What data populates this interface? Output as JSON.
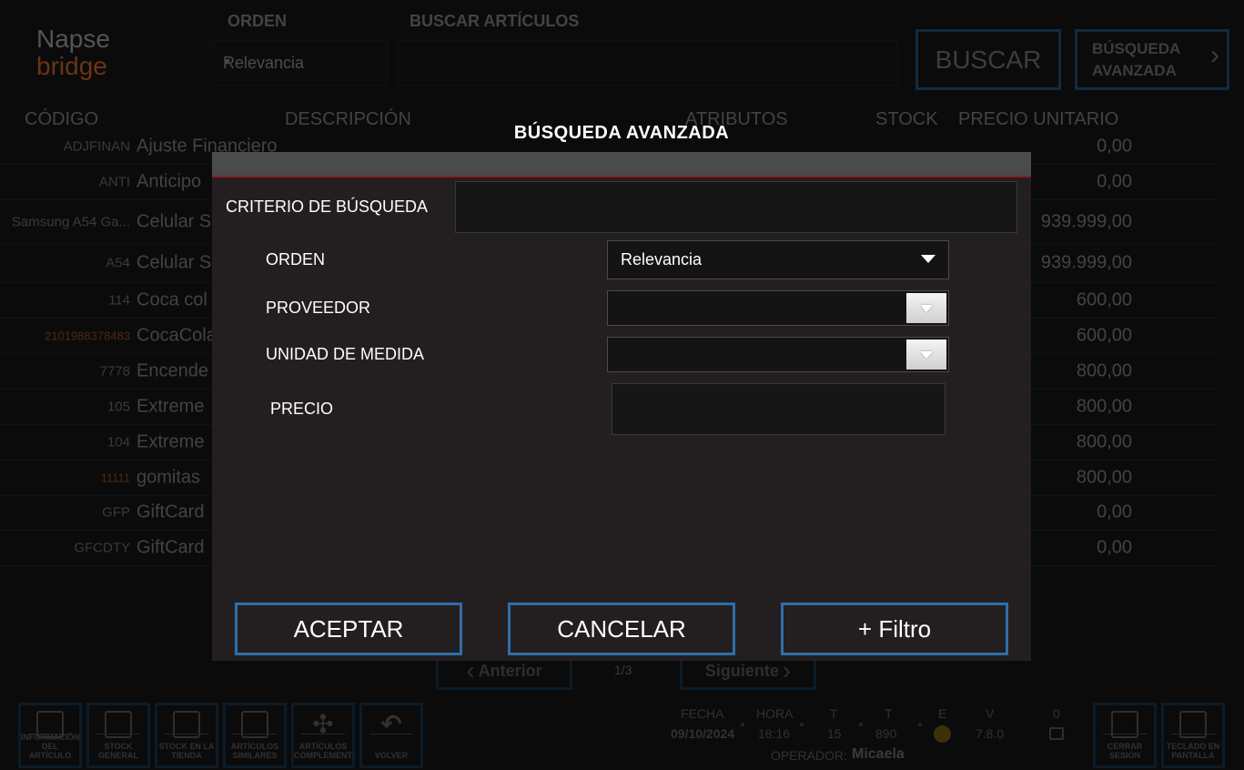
{
  "logo": {
    "line1": "Napse",
    "line2": "bridge"
  },
  "header": {
    "orden_label": "ORDEN",
    "orden_value": "Relevancia",
    "search_label": "BUSCAR ARTÍCULOS",
    "search_value": "",
    "buscar_button": "BUSCAR",
    "advanced_button_line1": "BÚSQUEDA",
    "advanced_button_line2": "AVANZADA"
  },
  "table": {
    "columns": [
      "CÓDIGO",
      "DESCRIPCIÓN",
      "ATRIBUTOS",
      "STOCK",
      "PRECIO UNITARIO"
    ],
    "rows": [
      {
        "code": "ADJFINAN",
        "desc": "Ajuste Financiero",
        "price": "0,00"
      },
      {
        "code": "ANTI",
        "desc": "Anticipo",
        "price": "0,00"
      },
      {
        "code": "Samsung A54 Ga...",
        "desc": "Celular S",
        "price": "939.999,00"
      },
      {
        "code": "A54",
        "desc": "Celular S",
        "price": "939.999,00"
      },
      {
        "code": "114",
        "desc": "Coca col",
        "price": "600,00"
      },
      {
        "code": "2101988378483",
        "desc": "CocaCola",
        "price": "600,00"
      },
      {
        "code": "7778",
        "desc": "Encende",
        "price": "800,00"
      },
      {
        "code": "105",
        "desc": "Extreme",
        "price": "800,00"
      },
      {
        "code": "104",
        "desc": "Extreme",
        "price": "800,00"
      },
      {
        "code": "11111",
        "desc": "gomitas",
        "price": "800,00"
      },
      {
        "code": "GFP",
        "desc": "GiftCard",
        "price": "0,00"
      },
      {
        "code": "GFCDTY",
        "desc": "GiftCard",
        "price": "0,00"
      }
    ]
  },
  "pager": {
    "prev": "Anterior",
    "info": "1/3",
    "next": "Siguiente"
  },
  "toolbar": {
    "info_articulo": "INFORMACIÓN DEL ARTÍCULO",
    "stock_general": "STOCK GENERAL",
    "stock_tienda": "STOCK EN LA TIENDA",
    "articulos_similares": "ARTÍCULOS SIMILARES",
    "articulos_complement": "ARTÍCULOS COMPLEMENT.",
    "volver": "VOLVER",
    "cerrar_sesion": "CERRAR SESIÓN",
    "teclado": "TECLADO EN PANTALLA"
  },
  "status": {
    "fecha_label": "FECHA",
    "fecha": "09/10/2024",
    "hora_label": "HORA",
    "hora": "18:16",
    "t1_label": "T",
    "t1": "15",
    "t2_label": "T",
    "t2": "890",
    "e_label": "E",
    "v_label": "V",
    "v": "7.8.0",
    "count": "0",
    "operador_label": "OPERADOR:",
    "operador": "Micaela"
  },
  "modal": {
    "title": "BÚSQUEDA AVANZADA",
    "criterio_label": "CRITERIO DE BÚSQUEDA",
    "criterio_value": "",
    "orden_label": "ORDEN",
    "orden_value": "Relevancia",
    "proveedor_label": "PROVEEDOR",
    "proveedor_value": "",
    "unidad_label": "UNIDAD DE MEDIDA",
    "unidad_value": "",
    "precio_label": "PRECIO",
    "precio_value": "",
    "aceptar": "ACEPTAR",
    "cancelar": "CANCELAR",
    "filtro": "+ Filtro"
  },
  "colors": {
    "accent_border": "#2f6ea8",
    "modal_bg": "#231f20",
    "band_red": "#8b1c2a",
    "logo_orange": "#c0602a"
  }
}
